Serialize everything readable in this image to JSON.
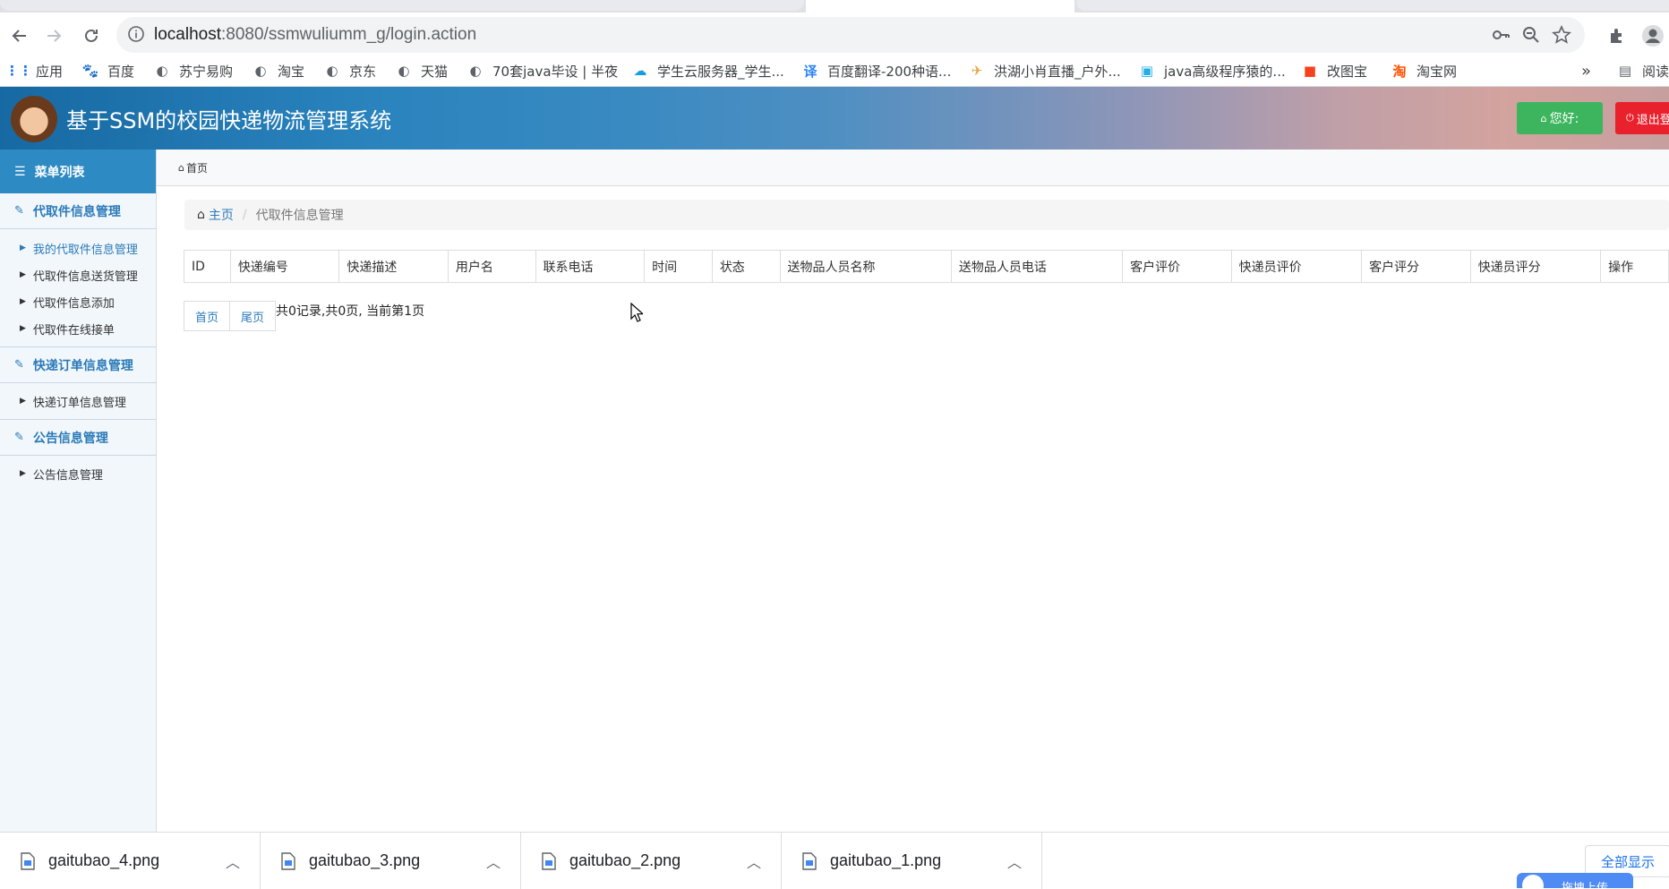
{
  "browser": {
    "url_host": "localhost",
    "url_rest": ":8080/ssmwuliumm_g/login.action",
    "bookmarks": [
      {
        "label": "应用",
        "icon": "apps-grid-icon",
        "color": "#1a73e8"
      },
      {
        "label": "百度",
        "icon": "baidu-paw-icon",
        "color": "#2932e1"
      },
      {
        "label": "苏宁易购",
        "icon": "globe-icon",
        "color": "#5f6368"
      },
      {
        "label": "淘宝",
        "icon": "globe-icon",
        "color": "#5f6368"
      },
      {
        "label": "京东",
        "icon": "globe-icon",
        "color": "#5f6368"
      },
      {
        "label": "天猫",
        "icon": "globe-icon",
        "color": "#5f6368"
      },
      {
        "label": "70套java毕设 | 半夜",
        "icon": "globe-icon",
        "color": "#5f6368"
      },
      {
        "label": "学生云服务器_学生...",
        "icon": "cloud-icon",
        "color": "#1a9bdc"
      },
      {
        "label": "百度翻译-200种语...",
        "icon": "translate-icon",
        "color": "#2b84f5"
      },
      {
        "label": "洪湖小肖直播_户外...",
        "icon": "bird-icon",
        "color": "#e8a33c"
      },
      {
        "label": "java高级程序猿的...",
        "icon": "bilibili-icon",
        "color": "#23ade5"
      },
      {
        "label": "改图宝",
        "icon": "gaitubao-icon",
        "color": "#f5421d"
      },
      {
        "label": "淘宝网",
        "icon": "taobao-icon",
        "color": "#ff5000"
      }
    ],
    "more_label": "»",
    "reading_label": "阅读"
  },
  "app": {
    "title": "基于SSM的校园快递物流管理系统",
    "greet_label": "您好:",
    "logout_label": "退出登录",
    "colors": {
      "header_start": "#1769a3",
      "green": "#3cb55e",
      "red": "#e8212d",
      "link": "#2a7ab8"
    }
  },
  "sidebar": {
    "menu_title": "菜单列表",
    "groups": [
      {
        "label": "代取件信息管理",
        "items": [
          "我的代取件信息管理",
          "代取件信息送货管理",
          "代取件信息添加",
          "代取件在线接单"
        ]
      },
      {
        "label": "快递订单信息管理",
        "items": [
          "快递订单信息管理"
        ]
      },
      {
        "label": "公告信息管理",
        "items": [
          "公告信息管理"
        ]
      }
    ]
  },
  "main": {
    "tab_label": "首页",
    "breadcrumb": {
      "home": "主页",
      "current": "代取件信息管理"
    },
    "table": {
      "columns": [
        "ID",
        "快递编号",
        "快递描述",
        "用户名",
        "联系电话",
        "时间",
        "状态",
        "送物品人员名称",
        "送物品人员电话",
        "客户评价",
        "快递员评价",
        "客户评分",
        "快递员评分",
        "操作"
      ],
      "rows": []
    },
    "pager": {
      "first": "首页",
      "last": "尾页",
      "info": "共0记录,共0页, 当前第1页"
    }
  },
  "downloads": {
    "files": [
      "gaitubao_4.png",
      "gaitubao_3.png",
      "gaitubao_2.png",
      "gaitubao_1.png"
    ],
    "show_all": "全部显示",
    "upload_label": "拖拽上传"
  }
}
